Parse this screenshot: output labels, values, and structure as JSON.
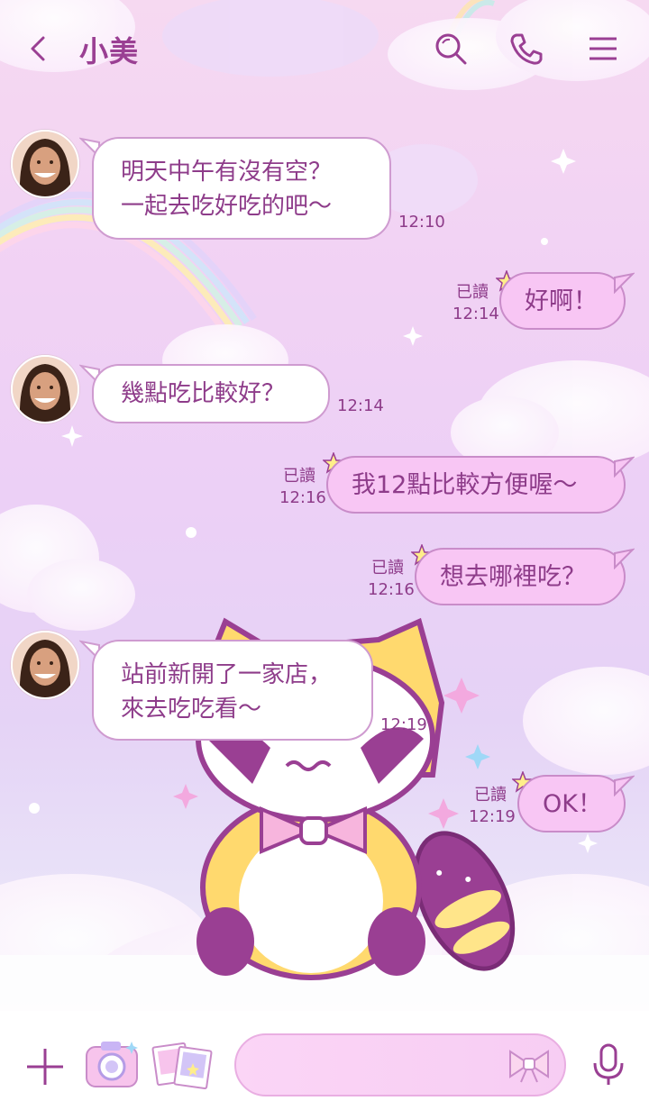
{
  "header": {
    "title": "小美",
    "back_icon": "chevron-left-icon",
    "search_icon": "search-icon",
    "call_icon": "phone-icon",
    "menu_icon": "menu-icon"
  },
  "messages": [
    {
      "side": "in",
      "text": "明天中午有沒有空？\n一起去吃好吃的吧～",
      "time": "12:10"
    },
    {
      "side": "out",
      "text": "好啊！",
      "read": "已讀",
      "time": "12:14"
    },
    {
      "side": "in",
      "text": "幾點吃比較好？",
      "time": "12:14"
    },
    {
      "side": "out",
      "text": "我12點比較方便喔～",
      "read": "已讀",
      "time": "12:16"
    },
    {
      "side": "out",
      "text": "想去哪裡吃？",
      "read": "已讀",
      "time": "12:16"
    },
    {
      "side": "in",
      "text": "站前新開了一家店，\n來去吃吃看～",
      "time": "12:19"
    },
    {
      "side": "out",
      "text": "OK！",
      "read": "已讀",
      "time": "12:19"
    }
  ],
  "bottom_bar": {
    "input_placeholder": "",
    "icons": [
      "plus-icon",
      "camera-icon",
      "photo-album-icon",
      "bow-sticker-icon",
      "microphone-icon"
    ]
  },
  "colors": {
    "accent": "#9a3f93",
    "outgoing_bubble": "#f8c6f4",
    "incoming_bubble": "#ffffff"
  }
}
